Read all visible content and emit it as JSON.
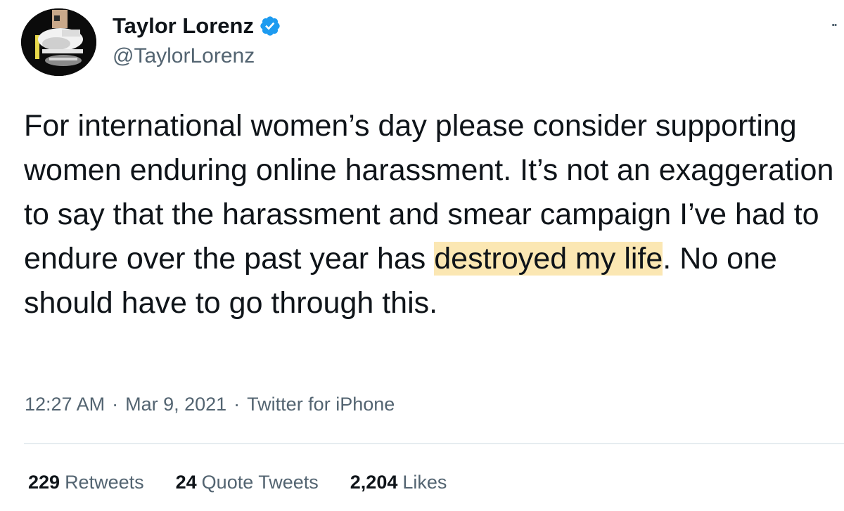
{
  "user": {
    "name": "Taylor Lorenz",
    "handle": "@TaylorLorenz",
    "verified_icon": "verified-badge-icon",
    "avatar_icon": "profile-photo"
  },
  "menu": {
    "icon": "more-options-icon",
    "glyph": "··"
  },
  "tweet": {
    "text_before": "For international women’s day please consider supporting women enduring online harassment. It’s not an exaggeration to say that the harassment and smear campaign I’ve had to endure over the past year has ",
    "highlighted": "destroyed my life",
    "text_after": ". No one should have to go through this."
  },
  "meta": {
    "time": "12:27 AM",
    "separator": "·",
    "date": "Mar 9, 2021",
    "source": "Twitter for iPhone"
  },
  "stats": {
    "retweets_count": "229",
    "retweets_label": "Retweets",
    "quote_count": "24",
    "quote_label": "Quote Tweets",
    "likes_count": "2,204",
    "likes_label": "Likes"
  },
  "colors": {
    "verified_blue": "#1d9bf0",
    "highlight": "#fbe7b3",
    "secondary_text": "#536471",
    "primary_text": "#0f1419",
    "divider": "#e6ecf0"
  }
}
